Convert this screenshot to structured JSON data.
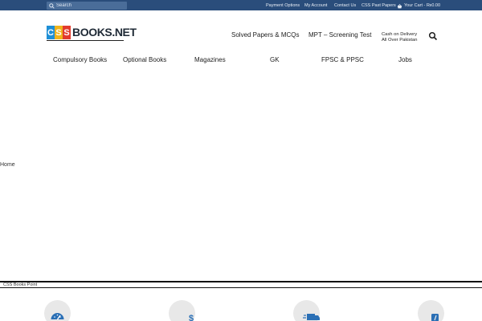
{
  "topbar": {
    "search_placeholder": "Search",
    "links": [
      "Payment Options",
      "My Account",
      "Contact Us",
      "CSS Past Papers"
    ],
    "cart_label": "Your Cart - ₨0.00"
  },
  "logo": {
    "letters": [
      "C",
      "S",
      "S"
    ],
    "rest": "BOOKS.NET",
    "colors": [
      "#1e8fd6",
      "#f0b41c",
      "#e23b2e"
    ]
  },
  "header": {
    "nav": [
      "Solved Papers & MCQs",
      "MPT – Screening Test"
    ],
    "cod_line1": "Cash on Delivery",
    "cod_line2": "All Over Pakistan"
  },
  "categories": [
    "Compulsory Books",
    "Optional Books",
    "Magazines",
    "GK",
    "FPSC & PPSC",
    "Jobs"
  ],
  "breadcrumb": {
    "home": "Home"
  },
  "footer": {
    "label": "CSS Books Point"
  },
  "features": [
    {
      "icon": "speedometer-icon"
    },
    {
      "icon": "dollar-icon"
    },
    {
      "icon": "delivery-truck-icon"
    },
    {
      "icon": "phone-icon"
    }
  ],
  "colors": {
    "topbar": "#2a4d7b",
    "icon_blue": "#2a6fb5",
    "circle_bg": "#e8e8e8"
  }
}
